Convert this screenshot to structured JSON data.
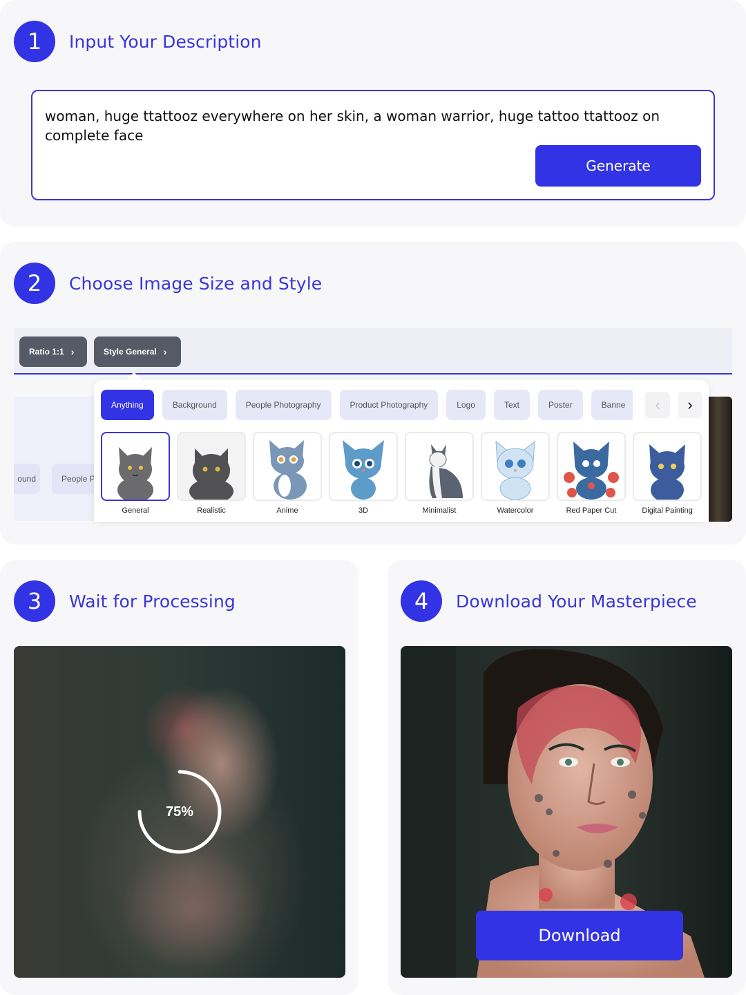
{
  "steps": [
    {
      "number": "1",
      "title": "Input Your Description"
    },
    {
      "number": "2",
      "title": "Choose Image Size and Style"
    },
    {
      "number": "3",
      "title": "Wait for Processing"
    },
    {
      "number": "4",
      "title": "Download Your Masterpiece"
    }
  ],
  "prompt": {
    "text": "woman, huge ttattooz everywhere on her skin, a woman warrior, huge tattoo ttattooz on complete face",
    "generate_label": "Generate"
  },
  "settings": {
    "ratio_label": "Ratio 1:1",
    "style_label": "Style General",
    "chevron": "›"
  },
  "behind_chips": [
    "ound",
    "People P"
  ],
  "categories": [
    "Anything",
    "Background",
    "People Photography",
    "Product Photography",
    "Logo",
    "Text",
    "Poster",
    "Banne"
  ],
  "active_category": "Anything",
  "nav": {
    "prev": "‹",
    "next": "›"
  },
  "styles": [
    "General",
    "Realistic",
    "Anime",
    "3D",
    "Minimalist",
    "Watercolor",
    "Red Paper Cut",
    "Digital Painting"
  ],
  "selected_style": "General",
  "processing": {
    "progress_label": "75%",
    "progress": 0.75
  },
  "download": {
    "label": "Download"
  },
  "colors": {
    "accent": "#3333e6",
    "title": "#3a36d9"
  }
}
